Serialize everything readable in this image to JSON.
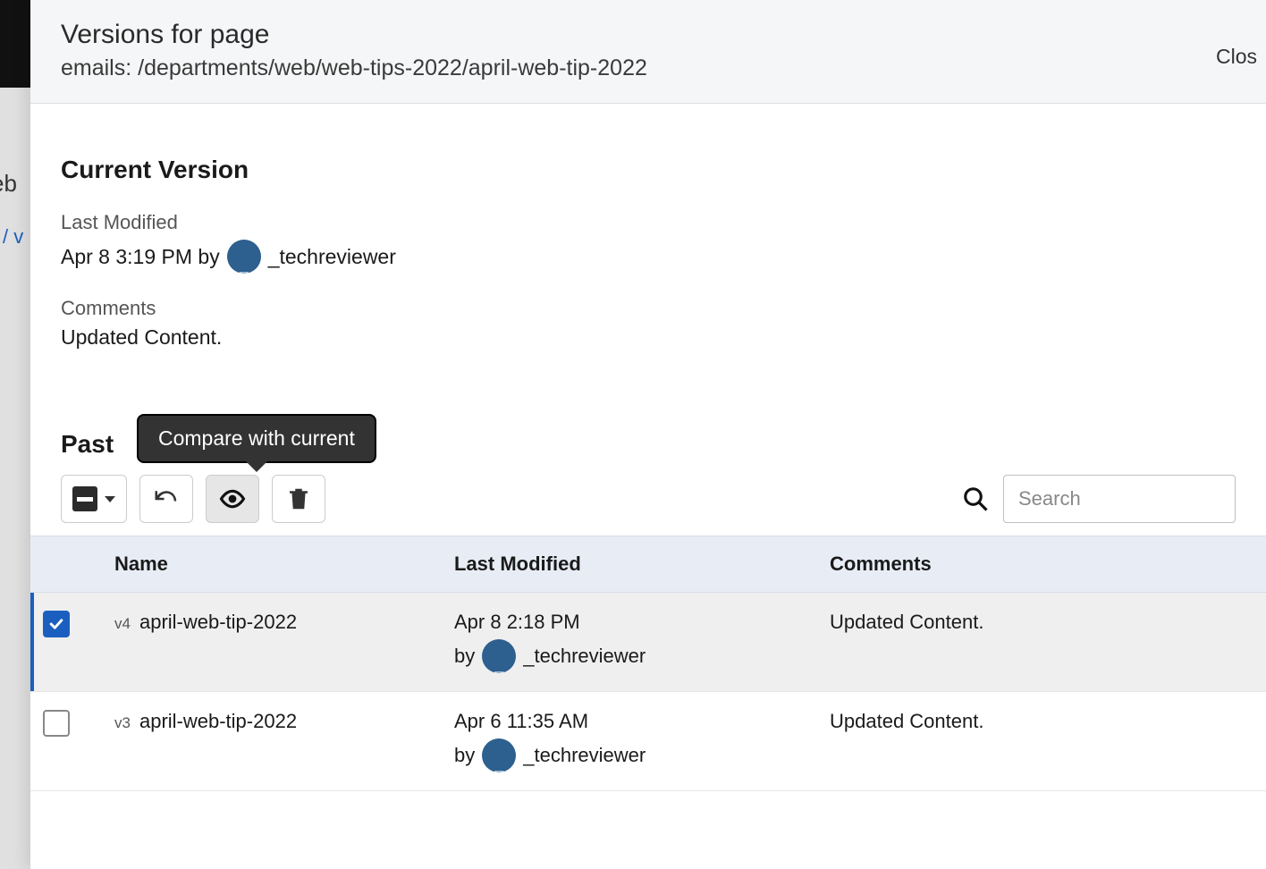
{
  "backdrop": {
    "text1": "eb",
    "text2": "/ v"
  },
  "header": {
    "title": "Versions for page",
    "subtitle": "emails: /departments/web/web-tips-2022/april-web-tip-2022",
    "close": "Clos"
  },
  "current": {
    "heading": "Current Version",
    "last_modified_label": "Last Modified",
    "last_modified_value_pre": "Apr 8 3:19 PM by",
    "user": "_techreviewer",
    "comments_label": "Comments",
    "comments_value": "Updated Content."
  },
  "tooltip": "Compare with current",
  "past": {
    "heading": "Past",
    "search_placeholder": "Search",
    "columns": {
      "name": "Name",
      "modified": "Last Modified",
      "comments": "Comments"
    }
  },
  "versions": [
    {
      "checked": true,
      "tag": "v4",
      "name": "april-web-tip-2022",
      "modified": "Apr 8 2:18 PM",
      "by_prefix": "by",
      "user": "_techreviewer",
      "comments": "Updated Content."
    },
    {
      "checked": false,
      "tag": "v3",
      "name": "april-web-tip-2022",
      "modified": "Apr 6 11:35 AM",
      "by_prefix": "by",
      "user": "_techreviewer",
      "comments": "Updated Content."
    }
  ]
}
